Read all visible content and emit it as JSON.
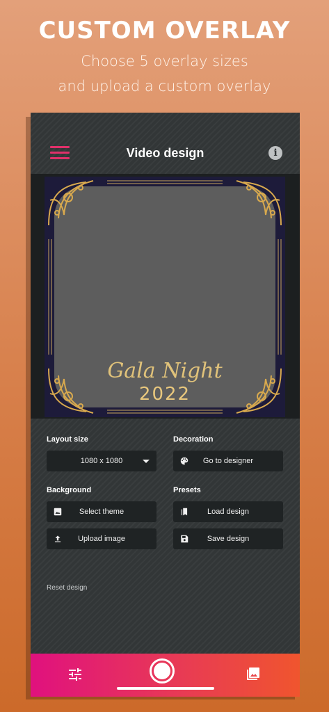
{
  "promo": {
    "title": "CUSTOM OVERLAY",
    "subtitle_line1": "Choose 5 overlay sizes",
    "subtitle_line2": "and upload a custom overlay"
  },
  "app": {
    "title": "Video design"
  },
  "overlay": {
    "script_text": "Gala Night",
    "year_text": "2022"
  },
  "layout_size": {
    "label": "Layout size",
    "selected": "1080 x 1080"
  },
  "decoration": {
    "label": "Decoration",
    "button": "Go to designer"
  },
  "background": {
    "label": "Background",
    "select_theme": "Select theme",
    "upload_image": "Upload image"
  },
  "presets": {
    "label": "Presets",
    "load": "Load design",
    "save": "Save design"
  },
  "reset": "Reset design",
  "colors": {
    "accent_pink": "#e0306a",
    "gradient_start": "#e0117e",
    "gradient_end": "#f0552e",
    "gold": "#e0c27a",
    "panel": "#323637"
  },
  "icons": {
    "menu": "hamburger-icon",
    "info": "info-icon",
    "palette": "palette-icon",
    "image": "image-icon",
    "upload": "upload-icon",
    "book": "bookmarks-icon",
    "save": "save-icon",
    "sliders": "tune-icon",
    "record": "record-icon",
    "gallery": "gallery-icon"
  }
}
